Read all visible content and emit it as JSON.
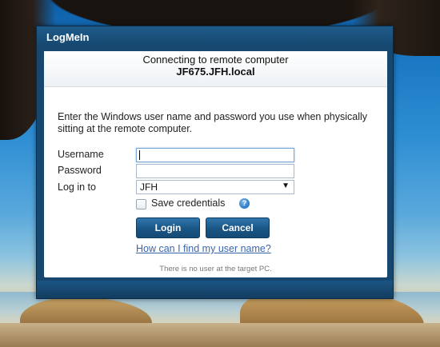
{
  "window": {
    "title": "LogMeIn"
  },
  "header": {
    "connecting_text": "Connecting to remote computer",
    "hostname": "JF675.JFH.local"
  },
  "form": {
    "instructions": "Enter the Windows user name and password you use when physically sitting at the remote computer.",
    "username_label": "Username",
    "username_value": "",
    "password_label": "Password",
    "password_value": "",
    "login_to_label": "Log in to",
    "login_to_value": "JFH",
    "save_credentials_label": "Save credentials",
    "save_credentials_checked": false
  },
  "buttons": {
    "login": "Login",
    "cancel": "Cancel"
  },
  "help_link": "How can I find my user name?",
  "status_text": "There is no user at the target PC.",
  "colors": {
    "accent": "#1a5584",
    "link": "#3a66b0"
  }
}
